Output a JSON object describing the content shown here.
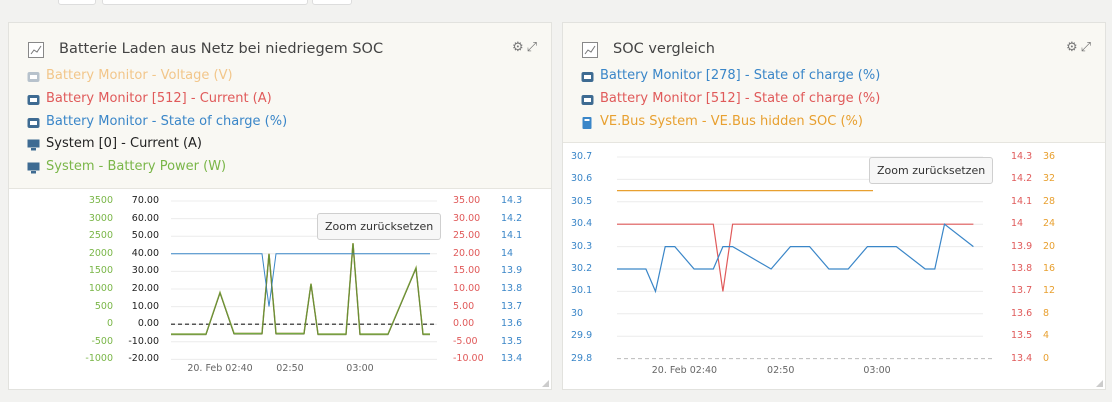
{
  "widgets": [
    {
      "title": "Batterie Laden aus Netz bei niedriegem SOC",
      "legend": [
        {
          "device": "Battery Monitor",
          "text": " - Voltage (V)",
          "color": "#f2c68a",
          "icon": "battery-monitor-icon"
        },
        {
          "device": "Battery Monitor [512]",
          "text": " - Current (A)",
          "color": "#e05a5a",
          "icon": "battery-monitor-icon"
        },
        {
          "device": "Battery Monitor",
          "text": " - State of charge (%)",
          "color": "#3a86c8",
          "icon": "battery-monitor-icon"
        },
        {
          "device": "System [0]",
          "text": " - Current (A)",
          "color": "#222222",
          "icon": "system-icon"
        },
        {
          "device": "System",
          "text": " - Battery Power (W)",
          "color": "#7ab648",
          "icon": "system-icon"
        }
      ],
      "zoom_label": "Zoom zurücksetzen",
      "axes": {
        "power": [
          "3500",
          "3000",
          "2500",
          "2000",
          "1500",
          "1000",
          "500",
          "0",
          "-500",
          "-1000"
        ],
        "current": [
          "70.00",
          "60.00",
          "50.00",
          "40.00",
          "30.00",
          "20.00",
          "10.00",
          "0.00",
          "-10.00",
          "-20.00"
        ],
        "current2": [
          "35.00",
          "30.00",
          "25.00",
          "20.00",
          "15.00",
          "10.00",
          "5.00",
          "0.00",
          "-5.00",
          "-10.00"
        ],
        "voltage": [
          "14.3",
          "14.2",
          "14.1",
          "14",
          "13.9",
          "13.8",
          "13.7",
          "13.6",
          "13.5",
          "13.4"
        ],
        "x": [
          "20. Feb 02:40",
          "02:50",
          "03:00"
        ]
      }
    },
    {
      "title": "SOC vergleich",
      "legend": [
        {
          "device": "Battery Monitor [278]",
          "text": " - State of charge (%)",
          "color": "#3a86c8",
          "icon": "battery-monitor-icon"
        },
        {
          "device": "Battery Monitor [512]",
          "text": " - State of charge (%)",
          "color": "#e05a5a",
          "icon": "battery-monitor-icon"
        },
        {
          "device": "VE.Bus System",
          "text": " - VE.Bus hidden SOC (%)",
          "color": "#e8a030",
          "icon": "vebus-icon"
        }
      ],
      "zoom_label": "Zoom zurücksetzen",
      "axes": {
        "soc": [
          "30.7",
          "30.6",
          "30.5",
          "30.4",
          "30.3",
          "30.2",
          "30.1",
          "30",
          "29.9",
          "29.8"
        ],
        "mid": [
          "14.3",
          "14.2",
          "14.1",
          "14",
          "13.9",
          "13.8",
          "13.7",
          "13.6",
          "13.5",
          "13.4"
        ],
        "right": [
          "36",
          "32",
          "28",
          "24",
          "20",
          "16",
          "12",
          "8",
          "4",
          "0"
        ],
        "x": [
          "20. Feb 02:40",
          "02:50",
          "03:00"
        ]
      }
    }
  ],
  "chart_data": [
    {
      "type": "line",
      "title": "Batterie Laden aus Netz bei niedriegem SOC",
      "x": [
        "02:33",
        "02:38",
        "02:40",
        "02:42",
        "02:46",
        "02:47",
        "02:48",
        "02:52",
        "02:53",
        "02:54",
        "02:58",
        "02:59",
        "03:00",
        "03:04",
        "03:08",
        "03:09",
        "03:10"
      ],
      "series": [
        {
          "name": "Battery Monitor [512] - Current (A)",
          "axis_range": [
            -10,
            35
          ],
          "values": [
            -2.8,
            -2.8,
            9,
            -2.6,
            -2.6,
            20,
            -2.6,
            -2.6,
            11.5,
            -2.8,
            -2.8,
            23,
            -2.8,
            -2.8,
            16,
            -2.8,
            -2.8
          ]
        },
        {
          "name": "Battery Monitor - State of charge (%)",
          "axis_range": [
            13.4,
            14.3
          ],
          "values": [
            14,
            14,
            14,
            14,
            14,
            13.7,
            14,
            14,
            14,
            14,
            14,
            14,
            14,
            14,
            14,
            14,
            14
          ]
        },
        {
          "name": "System - Battery Power (W)",
          "axis_range": [
            -1000,
            3500
          ],
          "values": [
            -280,
            -280,
            900,
            -260,
            -260,
            2000,
            -260,
            -260,
            1150,
            -280,
            -280,
            2300,
            -280,
            -280,
            1600,
            -280,
            -280
          ]
        }
      ],
      "ylim_power": [
        -1000,
        3500
      ],
      "ylim_current": [
        -20,
        70
      ],
      "ylim_current2": [
        -10,
        35
      ],
      "ylim_voltage": [
        13.4,
        14.3
      ]
    },
    {
      "type": "line",
      "title": "SOC vergleich",
      "x": [
        "02:33",
        "02:36",
        "02:37",
        "02:38",
        "02:39",
        "02:41",
        "02:43",
        "02:44",
        "02:45",
        "02:49",
        "02:51",
        "02:53",
        "02:55",
        "02:57",
        "02:59",
        "03:02",
        "03:05",
        "03:06",
        "03:07",
        "03:10"
      ],
      "series": [
        {
          "name": "Battery Monitor [278] - State of charge (%)",
          "axis_range": [
            29.8,
            30.7
          ],
          "values": [
            30.2,
            30.2,
            30.1,
            30.3,
            30.3,
            30.2,
            30.2,
            30.3,
            30.3,
            30.2,
            30.3,
            30.3,
            30.2,
            30.2,
            30.3,
            30.3,
            30.2,
            30.2,
            30.4,
            30.3
          ]
        },
        {
          "name": "Battery Monitor [512] - State of charge (%)",
          "axis_range": [
            13.4,
            14.3
          ],
          "values": [
            14,
            14,
            14,
            14,
            14,
            14,
            14,
            13.7,
            14,
            14,
            14,
            14,
            14,
            14,
            14,
            14,
            14,
            14,
            14,
            14
          ]
        },
        {
          "name": "VE.Bus System - VE.Bus hidden SOC (%)",
          "axis_range": [
            0,
            36
          ],
          "values": [
            30,
            30,
            30,
            30,
            30,
            30,
            30,
            30,
            30,
            30,
            30,
            30,
            30,
            30,
            30,
            30,
            30,
            30,
            30,
            30
          ]
        }
      ],
      "ylim_soc": [
        29.8,
        30.7
      ],
      "ylim_mid": [
        13.4,
        14.3
      ],
      "ylim_right": [
        0,
        36
      ]
    }
  ]
}
